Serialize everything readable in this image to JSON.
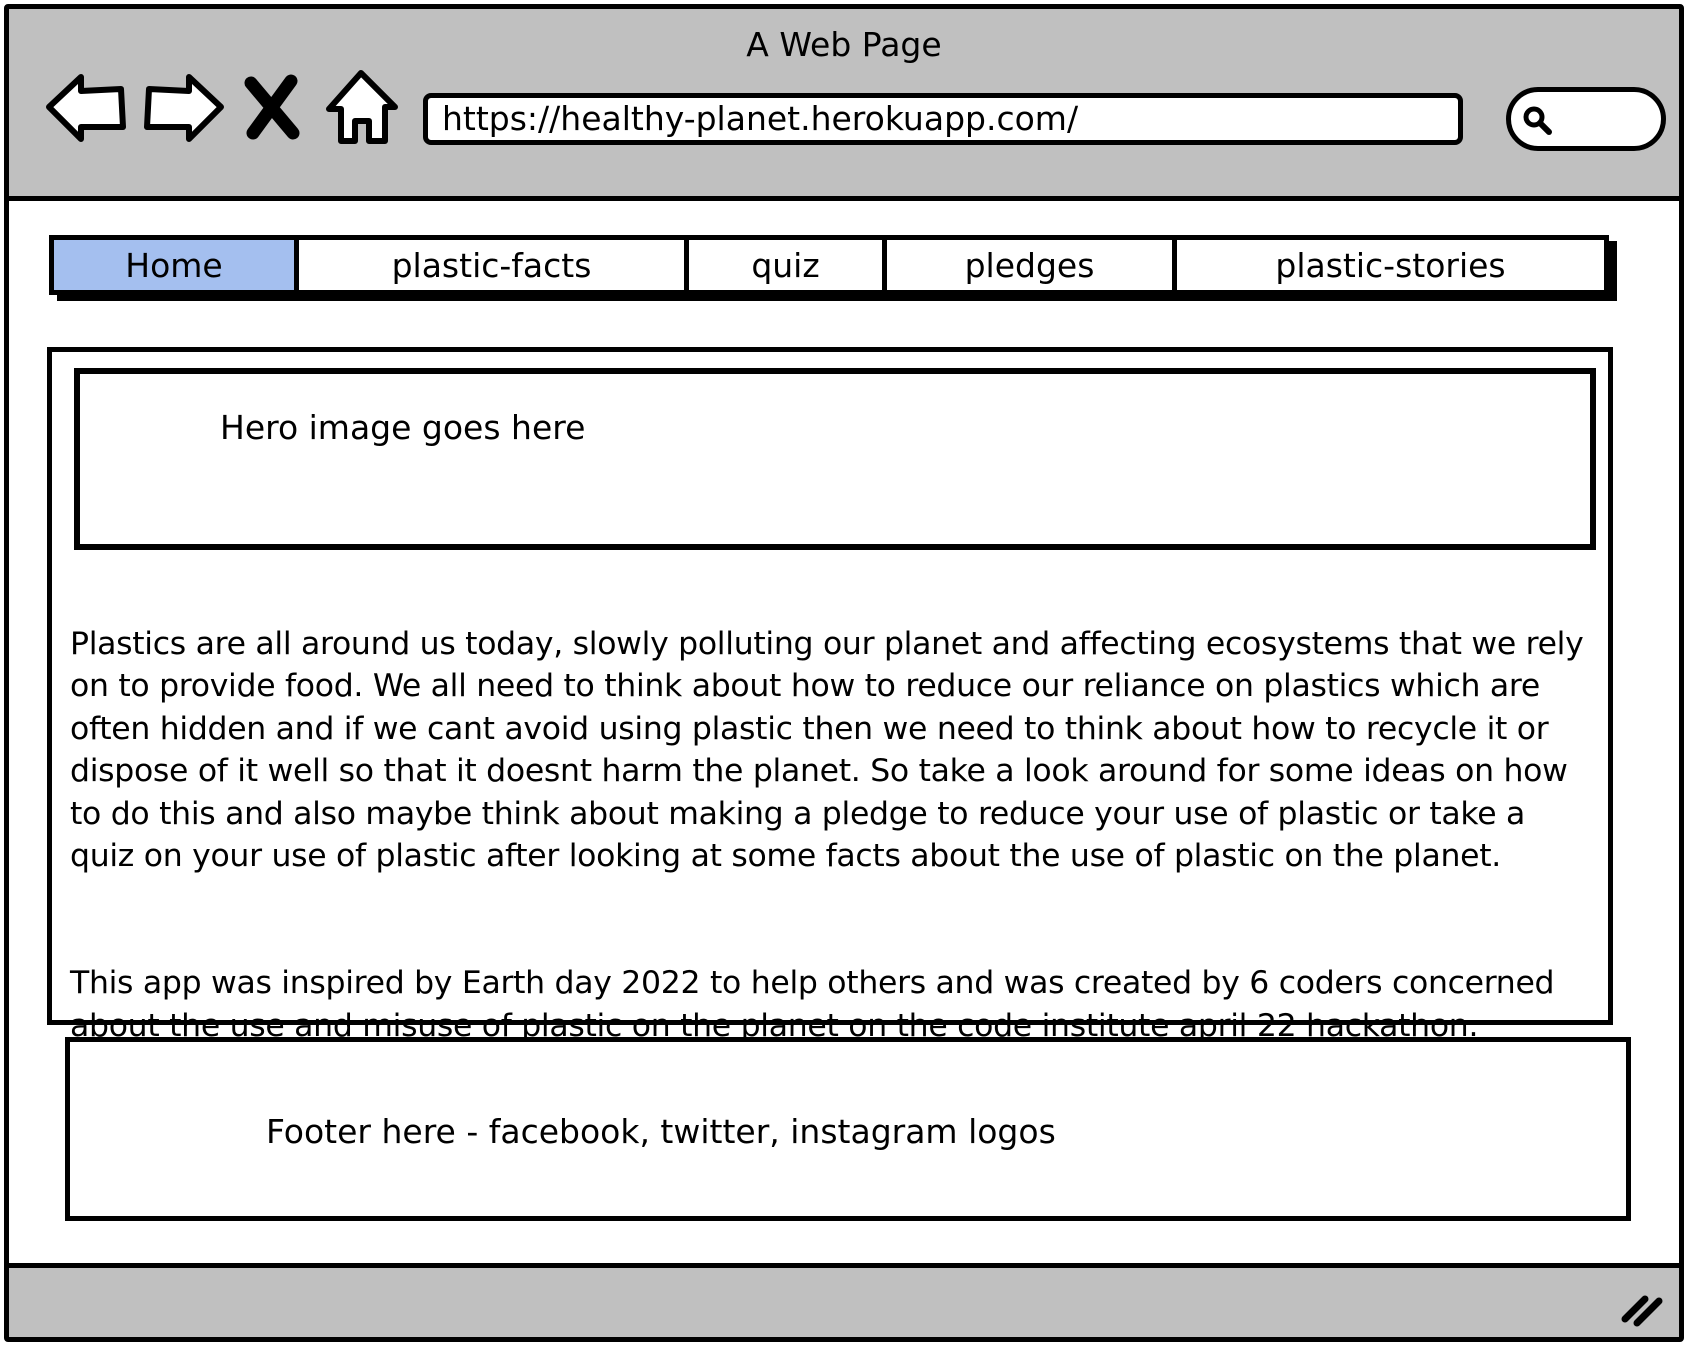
{
  "window": {
    "title": "A Web Page"
  },
  "toolbar": {
    "icons": [
      "back-arrow-icon",
      "forward-arrow-icon",
      "stop-x-icon",
      "home-icon"
    ],
    "url": "https://healthy-planet.herokuapp.com/",
    "search_icon": "search-icon"
  },
  "nav": {
    "tabs": [
      {
        "label": "Home",
        "active": true
      },
      {
        "label": "plastic-facts",
        "active": false
      },
      {
        "label": "quiz",
        "active": false
      },
      {
        "label": "pledges",
        "active": false
      },
      {
        "label": "plastic-stories",
        "active": false
      }
    ],
    "active_color": "#a4bfef"
  },
  "main": {
    "hero_text": "Hero image goes here",
    "paragraph_1": "Plastics are all around us today, slowly polluting our planet and affecting ecosystems that we rely\non to provide food.  We all need to think about how to reduce our reliance on plastics which are\noften hidden and if we cant avoid using plastic then we need to think about how to recycle it or\ndispose of it well so that it doesnt harm the planet.  So take a look around for some ideas on how\nto do this and also maybe think about making a pledge to reduce your use of plastic or take a\nquiz on your use of plastic after looking at some facts about the use of plastic on the planet.",
    "paragraph_2": "This app was inspired by Earth day 2022 to help others and was created by 6 coders concerned\nabout the use and misuse of plastic on the planet on the code institute april 22 hackathon."
  },
  "footer": {
    "text": "Footer here - facebook, twitter, instagram logos"
  },
  "colors": {
    "chrome_gray": "#c0c0c0",
    "border": "#000000"
  }
}
